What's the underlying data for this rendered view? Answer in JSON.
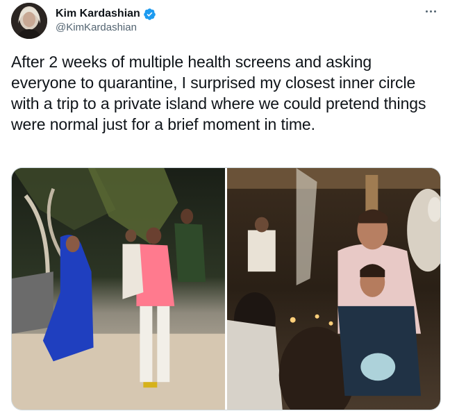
{
  "tweet": {
    "author": {
      "display_name": "Kim Kardashian",
      "handle": "@KimKardashian",
      "verified": true,
      "avatar_icon": "user-avatar"
    },
    "more_icon": "more-options-icon",
    "text": "After 2 weeks of multiple health screens and asking everyone to quarantine, I surprised my closest inner circle with a trip to a private island where we could pretend things were normal just for a brief moment in time.",
    "media": [
      {
        "alt": "",
        "icon": "photo-icon"
      },
      {
        "alt": "",
        "icon": "photo-icon"
      }
    ]
  },
  "colors": {
    "text_primary": "#0f1419",
    "text_secondary": "#536471",
    "verified_blue": "#1d9bf0",
    "border": "#cfd9de"
  }
}
